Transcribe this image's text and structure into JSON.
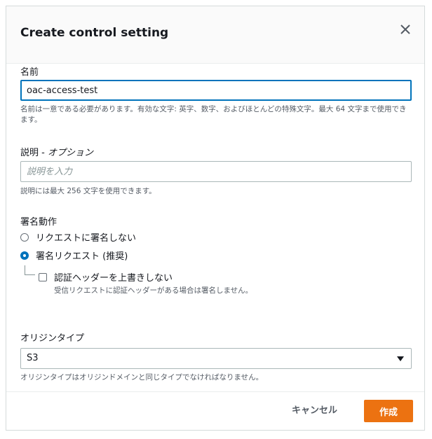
{
  "dialog": {
    "title": "Create control setting",
    "close_icon": "close-icon"
  },
  "name_field": {
    "label": "名前",
    "value": "oac-access-test",
    "hint": "名前は一意である必要があります。有効な文字: 英字、数字、およびほとんどの特殊文字。最大 64 文字まで使用できます。"
  },
  "description_field": {
    "label": "説明 - ",
    "label_optional": "オプション",
    "placeholder": "説明を入力",
    "hint": "説明には最大 256 文字を使用できます。"
  },
  "signing": {
    "label": "署名動作",
    "options": [
      {
        "label": "リクエストに署名しない",
        "selected": false
      },
      {
        "label": "署名リクエスト (推奨)",
        "selected": true
      }
    ],
    "override_checkbox": {
      "label": "認証ヘッダーを上書きしない",
      "checked": false,
      "hint": "受信リクエストに認証ヘッダーがある場合は署名しません。"
    }
  },
  "origin_type": {
    "label": "オリジンタイプ",
    "selected": "S3",
    "hint": "オリジンタイプはオリジンドメインと同じタイプでなければなりません。"
  },
  "footer": {
    "cancel_label": "キャンセル",
    "create_label": "作成"
  },
  "colors": {
    "primary": "#ec7211",
    "focus": "#0073bb"
  }
}
